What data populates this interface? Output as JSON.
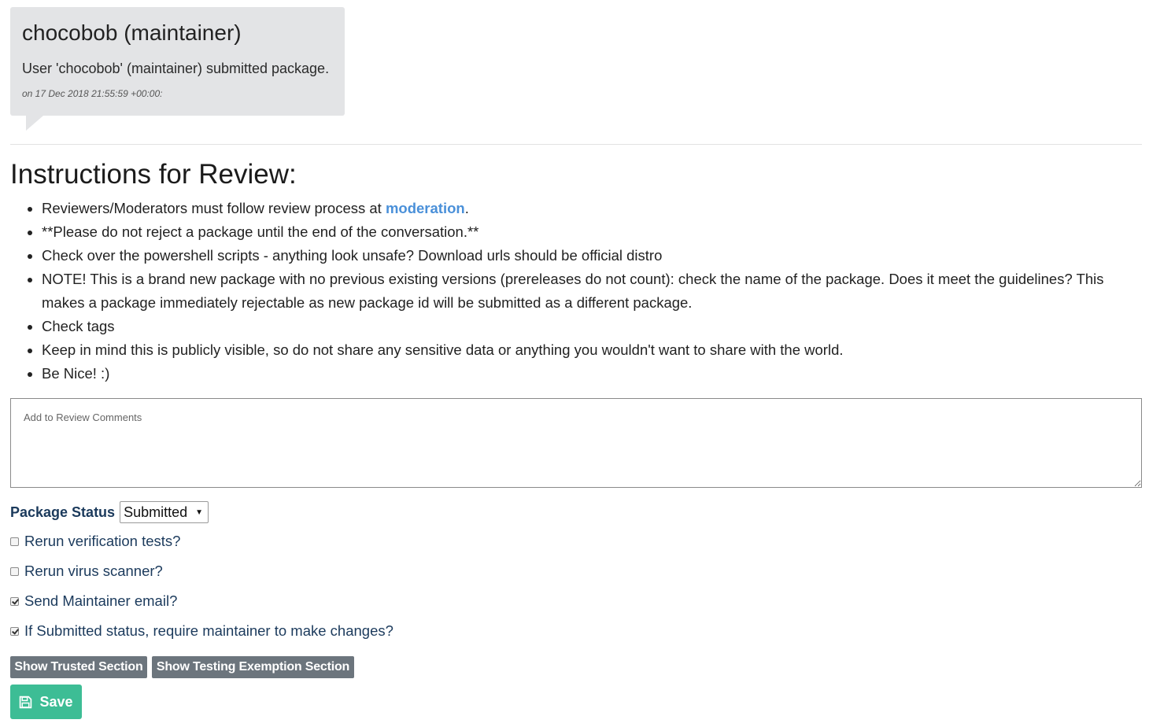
{
  "bubble": {
    "title": "chocobob (maintainer)",
    "message": "User 'chocobob' (maintainer) submitted package.",
    "date": "on 17 Dec 2018 21:55:59 +00:00:"
  },
  "review": {
    "title": "Instructions for Review:",
    "items": [
      {
        "before": "Reviewers/Moderators must follow review process at ",
        "link": "moderation",
        "after": "."
      },
      {
        "before": "**Please do not reject a package until the end of the conversation.**",
        "link": null,
        "after": ""
      },
      {
        "before": "Check over the powershell scripts - anything look unsafe? Download urls should be official distro",
        "link": null,
        "after": ""
      },
      {
        "before": "NOTE! This is a brand new package with no previous existing versions (prereleases do not count): check the name of the package. Does it meet the guidelines? This makes a package immediately rejectable as new package id will be submitted as a different package.",
        "link": null,
        "after": ""
      },
      {
        "before": "Check tags",
        "link": null,
        "after": ""
      },
      {
        "before": "Keep in mind this is publicly visible, so do not share any sensitive data or anything you wouldn't want to share with the world.",
        "link": null,
        "after": ""
      },
      {
        "before": "Be Nice! :)",
        "link": null,
        "after": ""
      }
    ]
  },
  "comments": {
    "placeholder": "Add to Review Comments",
    "value": ""
  },
  "status": {
    "label": "Package Status",
    "selected": "Submitted"
  },
  "options": [
    {
      "label": "Rerun verification tests?",
      "checked": false
    },
    {
      "label": "Rerun virus scanner?",
      "checked": false
    },
    {
      "label": "Send Maintainer email?",
      "checked": true
    },
    {
      "label": "If Submitted status, require maintainer to make changes?",
      "checked": true
    }
  ],
  "buttons": {
    "trusted": "Show Trusted Section",
    "exemption": "Show Testing Exemption Section",
    "save": "Save"
  },
  "colors": {
    "save_button": "#3dbd95",
    "grey_button": "#6c757d",
    "link": "#4a90d9",
    "label": "#1b3a5c"
  },
  "icons": {
    "save": "floppy-disk-icon",
    "select": "caret-down-icon"
  }
}
